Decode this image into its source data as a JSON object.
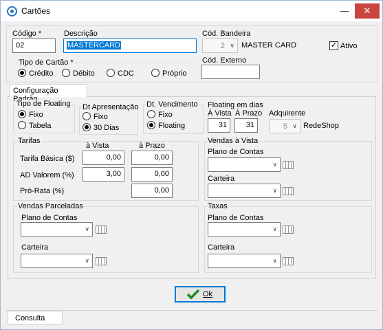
{
  "window": {
    "title": "Cartões"
  },
  "header": {
    "codigo_label": "Código *",
    "codigo_value": "02",
    "descricao_label": "Descrição",
    "descricao_value": "MASTERCARD",
    "cod_bandeira_label": "Cód. Bandeira",
    "cod_bandeira_value": "2",
    "bandeira_name": "MASTER CARD",
    "ativo_label": "Ativo",
    "ativo_checked": true,
    "cod_externo_label": "Cód. Externo",
    "cod_externo_value": "",
    "tipo_cartao_label": "Tipo de Cartão *",
    "tipos": [
      "Crédito",
      "Débito",
      "CDC",
      "Próprio"
    ],
    "tipo_selected": "Crédito"
  },
  "tabs": {
    "main": "Configuração Padrão",
    "bottom": "Consulta"
  },
  "floating_type": {
    "title": "Tipo de Floating",
    "options": [
      "Fixo",
      "Tabela"
    ],
    "selected": "Fixo"
  },
  "dt_apresentacao": {
    "title": "Dt Apresentação",
    "options": [
      "Fixo",
      "30 Dias"
    ],
    "selected": "30 Dias"
  },
  "dt_vencimento": {
    "title": "Dt. Vencimento",
    "options": [
      "Fixo",
      "Floating"
    ],
    "selected": "Floating"
  },
  "floating_dias": {
    "title": "Floating em dias",
    "vista_label": "À Vista",
    "prazo_label": "À Prazo",
    "vista_value": "31",
    "prazo_value": "31"
  },
  "adquirente": {
    "label": "Adquirente",
    "value": "5",
    "name": "RedeShop"
  },
  "tarifas": {
    "title": "Tarifas",
    "col_vista": "à Vista",
    "col_prazo": "à Prazo",
    "rows": [
      {
        "label": "Tarifa Básica ($)",
        "vista": "0,00",
        "prazo": "0,00"
      },
      {
        "label": "AD Valorem (%)",
        "vista": "3,00",
        "prazo": "0,00"
      },
      {
        "label": "Pró-Rata (%)",
        "prazo": "0,00"
      }
    ]
  },
  "vendas_vista": {
    "title": "Vendas à Vista",
    "plano_label": "Plano de Contas",
    "carteira_label": "Carteira"
  },
  "vendas_parceladas": {
    "title": "Vendas Parceladas",
    "plano_label": "Plano de Contas",
    "carteira_label": "Carteira"
  },
  "taxas": {
    "title": "Taxas",
    "plano_label": "Plano de Contas",
    "carteira_label": "Carteira"
  },
  "ok_button": {
    "label": "Ok"
  },
  "colors": {
    "accent": "#0078d7",
    "close": "#c8463f",
    "check": "#1d8a1d"
  }
}
